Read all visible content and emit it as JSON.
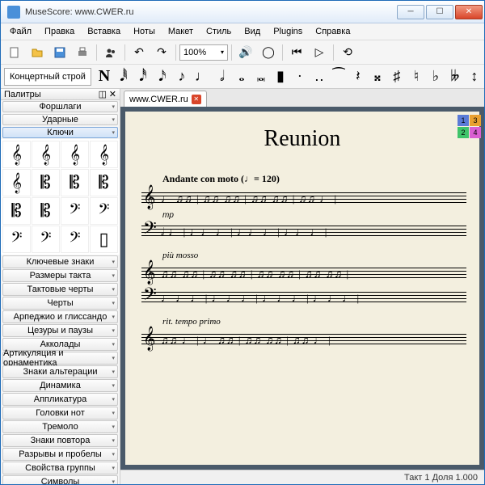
{
  "window": {
    "title": "MuseScore: www.CWER.ru"
  },
  "menu": [
    "Файл",
    "Правка",
    "Вставка",
    "Ноты",
    "Макет",
    "Стиль",
    "Вид",
    "Plugins",
    "Справка"
  ],
  "toolbar": {
    "zoom": "100%"
  },
  "notebar": {
    "concert": "Концертный строй",
    "n": "N"
  },
  "voices": [
    "1",
    "3",
    "2",
    "4"
  ],
  "palettes": {
    "title": "Палитры",
    "top": [
      "Форшлаги",
      "Ударные",
      "Ключи"
    ],
    "bottom": [
      "Ключевые знаки",
      "Размеры такта",
      "Тактовые черты",
      "Черты",
      "Арпеджио и глиссандо",
      "Цезуры и паузы",
      "Акколады",
      "Артикуляция и орнаментика",
      "Знаки альтерации",
      "Динамика",
      "Аппликатура",
      "Головки нот",
      "Тремоло",
      "Знаки повтора",
      "Разрывы и пробелы",
      "Свойства группы",
      "Символы"
    ]
  },
  "tab": {
    "label": "www.CWER.ru"
  },
  "score": {
    "title": "Reunion",
    "tempo": "Andante con moto (♩= 120)",
    "expr1": "più mosso",
    "expr2": "rit.                    tempo primo",
    "dyn": "mp"
  },
  "status": "Такт  1 Доля  1.000"
}
